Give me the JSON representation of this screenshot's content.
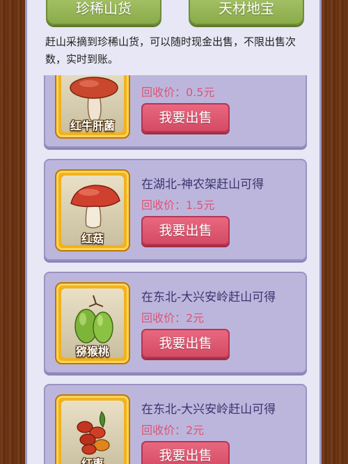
{
  "tabs": [
    "珍稀山货",
    "天材地宝"
  ],
  "description": "赶山采摘到珍稀山货，可以随时现金出售，不限出售次数，实时到账。",
  "items": [
    {
      "name": "红牛肝菌",
      "location": "",
      "price": "回收价：0.5元",
      "button": "我要出售",
      "icon": "red-bolete-mushroom-icon"
    },
    {
      "name": "红菇",
      "location": "在湖北-神农架赶山可得",
      "price": "回收价：1.5元",
      "button": "我要出售",
      "icon": "red-mushroom-icon"
    },
    {
      "name": "猕猴桃",
      "location": "在东北-大兴安岭赶山可得",
      "price": "回收价：2元",
      "button": "我要出售",
      "icon": "kiwi-fruit-icon"
    },
    {
      "name": "红枣",
      "location": "在东北-大兴安岭赶山可得",
      "price": "回收价：2元",
      "button": "我要出售",
      "icon": "red-date-icon"
    }
  ],
  "colors": {
    "accent_green": "#8aab4a",
    "sell_button": "#d44a64",
    "price_text": "#e05273",
    "card_bg": "#bdb6dc"
  }
}
